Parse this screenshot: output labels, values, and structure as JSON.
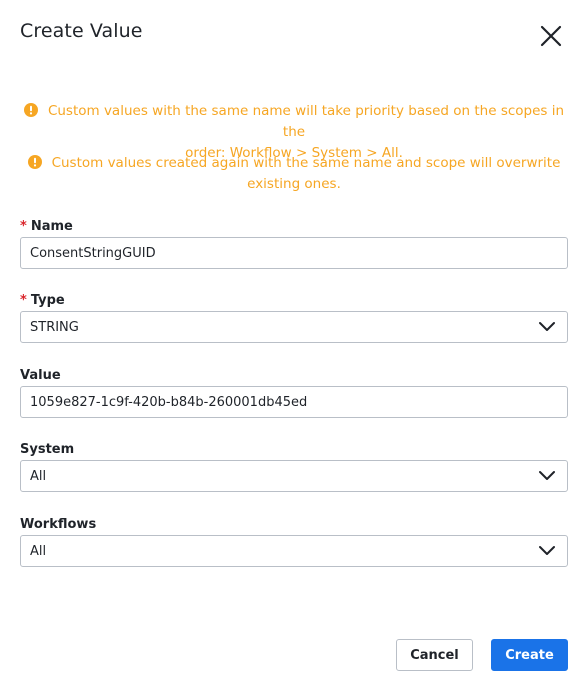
{
  "dialog": {
    "title": "Create Value",
    "notices": [
      {
        "line1": "Custom values with the same name will take priority based on the scopes in the",
        "line2": "order: Workflow > System > All."
      },
      {
        "line1": "Custom values created again with the same name and scope will overwrite",
        "line2": "existing ones."
      }
    ],
    "fields": {
      "name": {
        "required_mark": "*",
        "label": "Name",
        "value": "ConsentStringGUID"
      },
      "type": {
        "required_mark": "*",
        "label": "Type",
        "value": "STRING"
      },
      "value": {
        "label": "Value",
        "value": "1059e827-1c9f-420b-b84b-260001db45ed"
      },
      "system": {
        "label": "System",
        "value": "All"
      },
      "workflows": {
        "label": "Workflows",
        "value": "All"
      }
    },
    "buttons": {
      "cancel": "Cancel",
      "create": "Create"
    }
  },
  "colors": {
    "warning": "#f6a623",
    "primary": "#1a73e8",
    "required": "#d9262c",
    "border": "#b9bfc7",
    "text": "#1f2329"
  },
  "icons": [
    "close-icon",
    "warning-icon",
    "chevron-down-icon"
  ]
}
